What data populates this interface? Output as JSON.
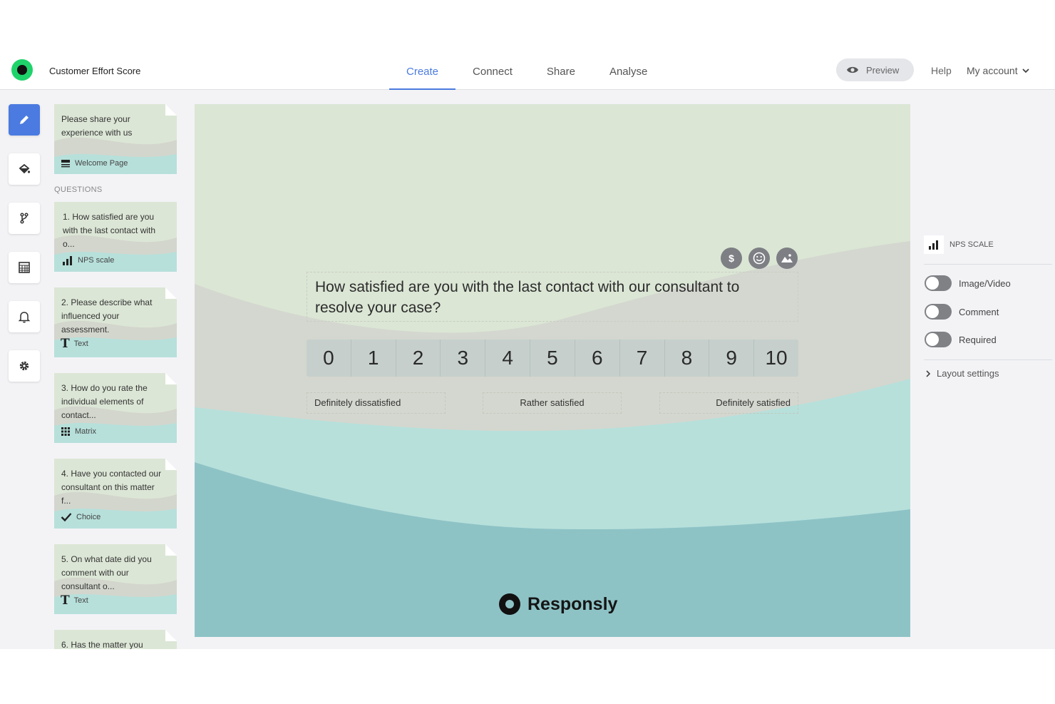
{
  "header": {
    "survey_title": "Customer Effort Score",
    "tabs": [
      {
        "label": "Create",
        "active": true
      },
      {
        "label": "Connect",
        "active": false
      },
      {
        "label": "Share",
        "active": false
      },
      {
        "label": "Analyse",
        "active": false
      }
    ],
    "preview_label": "Preview",
    "help_label": "Help",
    "account_label": "My account"
  },
  "rail": {
    "icons": [
      "pencil-icon",
      "paint-bucket-icon",
      "branch-icon",
      "calculator-icon",
      "bell-icon",
      "gear-icon"
    ],
    "accent": "#4b7be0"
  },
  "sidebar": {
    "welcome": {
      "text": "Please share your experience with us",
      "type": "Welcome Page"
    },
    "questions_heading": "QUESTIONS",
    "questions": [
      {
        "text": "1. How satisfied are you with the last contact with o...",
        "type": "NPS scale",
        "icon": "bar-chart-icon"
      },
      {
        "text": "2. Please describe what influenced your assessment.",
        "type": "Text",
        "icon": "text-icon"
      },
      {
        "text": "3. How do you rate the individual elements of contact...",
        "type": "Matrix",
        "icon": "grid-icon"
      },
      {
        "text": "4. Have you contacted our consultant on this matter f...",
        "type": "Choice",
        "icon": "check-icon"
      },
      {
        "text": "5. On what date did you comment with our consultant o...",
        "type": "Text",
        "icon": "text-icon"
      },
      {
        "text": "6. Has the matter you",
        "type": "",
        "icon": ""
      }
    ]
  },
  "canvas": {
    "question": "How satisfied are you with the last contact with our consultant to resolve your case?",
    "scale": [
      "0",
      "1",
      "2",
      "3",
      "4",
      "5",
      "6",
      "7",
      "8",
      "9",
      "10"
    ],
    "labels": {
      "left": "Definitely dissatisfied",
      "middle": "Rather satisfied",
      "right": "Definitely satisfied"
    },
    "media_icons": [
      "dollar-icon",
      "smiley-icon",
      "image-icon"
    ],
    "brand": "Responsly",
    "colors": {
      "top": "#dbe6d5",
      "band": "#d4d7cf",
      "mint": "#b7e0db",
      "teal": "#8ec3c6"
    }
  },
  "right_panel": {
    "type_label": "NPS SCALE",
    "toggles": [
      {
        "label": "Image/Video",
        "on": false
      },
      {
        "label": "Comment",
        "on": false
      },
      {
        "label": "Required",
        "on": false
      }
    ],
    "layout_settings": "Layout settings"
  }
}
